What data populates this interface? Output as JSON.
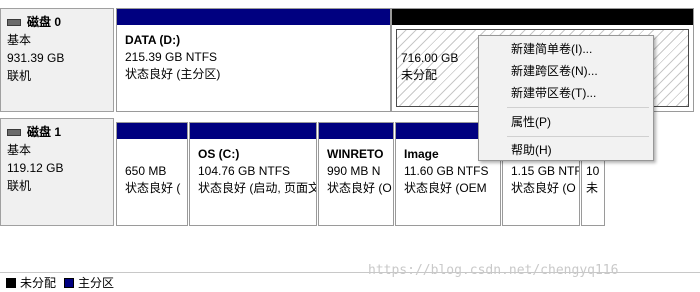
{
  "disks": [
    {
      "name": "磁盘 0",
      "type": "基本",
      "size": "931.39 GB",
      "status": "联机",
      "partitions": [
        {
          "name": "DATA  (D:)",
          "size": "215.39 GB NTFS",
          "status": "状态良好 (主分区)"
        },
        {
          "name": "",
          "size": "716.00 GB",
          "status": "未分配"
        }
      ]
    },
    {
      "name": "磁盘 1",
      "type": "基本",
      "size": "119.12 GB",
      "status": "联机",
      "partitions": [
        {
          "name": "",
          "size": "650 MB",
          "status": "状态良好 ("
        },
        {
          "name": "OS  (C:)",
          "size": "104.76 GB NTFS",
          "status": "状态良好 (启动, 页面文"
        },
        {
          "name": "WINRETO",
          "size": "990 MB N",
          "status": "状态良好 (O"
        },
        {
          "name": "Image",
          "size": "11.60 GB NTFS",
          "status": "状态良好 (OEM"
        },
        {
          "name": "",
          "size": "1.15 GB NTF",
          "status": "状态良好 (O"
        },
        {
          "name": "",
          "size": "10",
          "status": "未"
        }
      ]
    }
  ],
  "context_menu": {
    "items": [
      "新建简单卷(I)...",
      "新建跨区卷(N)...",
      "新建带区卷(T)...",
      "属性(P)",
      "帮助(H)"
    ]
  },
  "legend": {
    "unallocated": "未分配",
    "primary": "主分区",
    "unallocated_color": "#000000",
    "primary_color": "#000080"
  },
  "watermark": "https://blog.csdn.net/chengyq116",
  "icons": {
    "disk": "disk-icon"
  }
}
